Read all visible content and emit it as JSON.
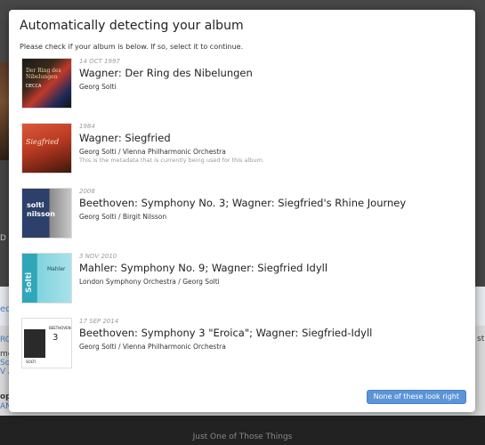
{
  "background": {
    "fragments": [
      "D R",
      "edi",
      "RC",
      "mei",
      "Solti",
      "V A",
      "ope",
      "ANC",
      "st"
    ],
    "caption": "Just One of Those Things"
  },
  "modal": {
    "title": "Automatically detecting your album",
    "description": "Please check if your album is below. If so, select it to continue.",
    "albums": [
      {
        "date": "14 OCT 1997",
        "title": "Wagner: Der Ring des Nibelungen",
        "artist": "Georg Solti",
        "note": "",
        "cover_text": [
          "Der Ring des Nibelungen",
          "DECCA"
        ]
      },
      {
        "date": "1984",
        "title": "Wagner: Siegfried",
        "artist": "Georg Solti / Vienna Philharmonic Orchestra",
        "note": "This is the metadata that is currently being used for this album.",
        "cover_text": [
          "Siegfried"
        ]
      },
      {
        "date": "2008",
        "title": "Beethoven: Symphony No. 3; Wagner: Siegfried's Rhine Journey",
        "artist": "Georg Solti / Birgit Nilsson",
        "note": "",
        "cover_text": [
          "solti",
          "nilsson"
        ]
      },
      {
        "date": "3 NOV 2010",
        "title": "Mahler: Symphony No. 9; Wagner: Siegfried Idyll",
        "artist": "London Symphony Orchestra / Georg Solti",
        "note": "",
        "cover_text": [
          "Solti",
          "Mahler"
        ]
      },
      {
        "date": "17 SEP 2014",
        "title": "Beethoven: Symphony 3 \"Eroica\"; Wagner: Siegfried-Idyll",
        "artist": "Georg Solti / Vienna Philharmonic Orchestra",
        "note": "",
        "cover_text": [
          "BEETHOVEN",
          "3",
          "SOLTI"
        ]
      }
    ],
    "none_button": "None of these look right"
  }
}
